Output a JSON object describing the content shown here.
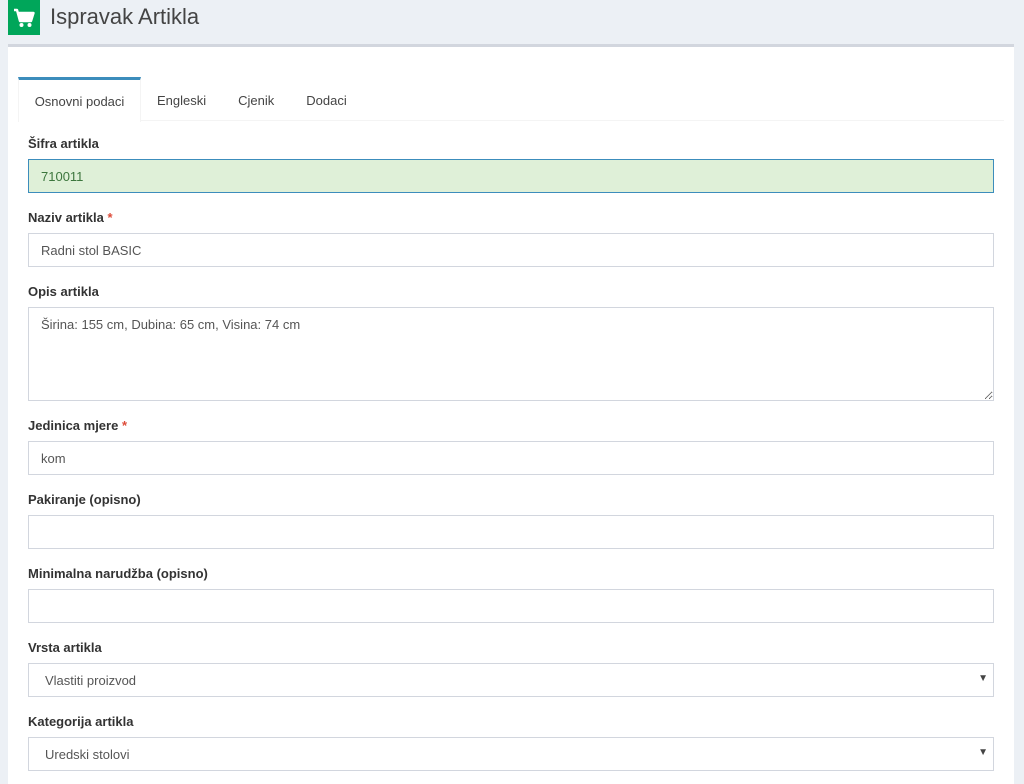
{
  "header": {
    "title": "Ispravak Artikla",
    "icon": "shopping-cart-icon",
    "icon_bg": "#00a65a"
  },
  "tabs": [
    {
      "label": "Osnovni podaci",
      "active": true
    },
    {
      "label": "Engleski",
      "active": false
    },
    {
      "label": "Cjenik",
      "active": false
    },
    {
      "label": "Dodaci",
      "active": false
    }
  ],
  "form": {
    "sifra": {
      "label": "Šifra artikla",
      "value": "710011"
    },
    "naziv": {
      "label": "Naziv artikla",
      "required": "*",
      "value": "Radni stol BASIC"
    },
    "opis": {
      "label": "Opis artikla",
      "value": "Širina: 155 cm, Dubina: 65 cm, Visina: 74 cm"
    },
    "jedinica": {
      "label": "Jedinica mjere",
      "required": "*",
      "value": "kom"
    },
    "pakiranje": {
      "label": "Pakiranje (opisno)",
      "value": ""
    },
    "min_narudzba": {
      "label": "Minimalna narudžba (opisno)",
      "value": ""
    },
    "vrsta": {
      "label": "Vrsta artikla",
      "selected": "Vlastiti proizvod"
    },
    "kategorija": {
      "label": "Kategorija artikla",
      "selected": "Uredski stolovi"
    }
  },
  "colors": {
    "accent": "#3c8dbc",
    "success_bg": "#dff0d8",
    "required": "#dd4b39"
  }
}
